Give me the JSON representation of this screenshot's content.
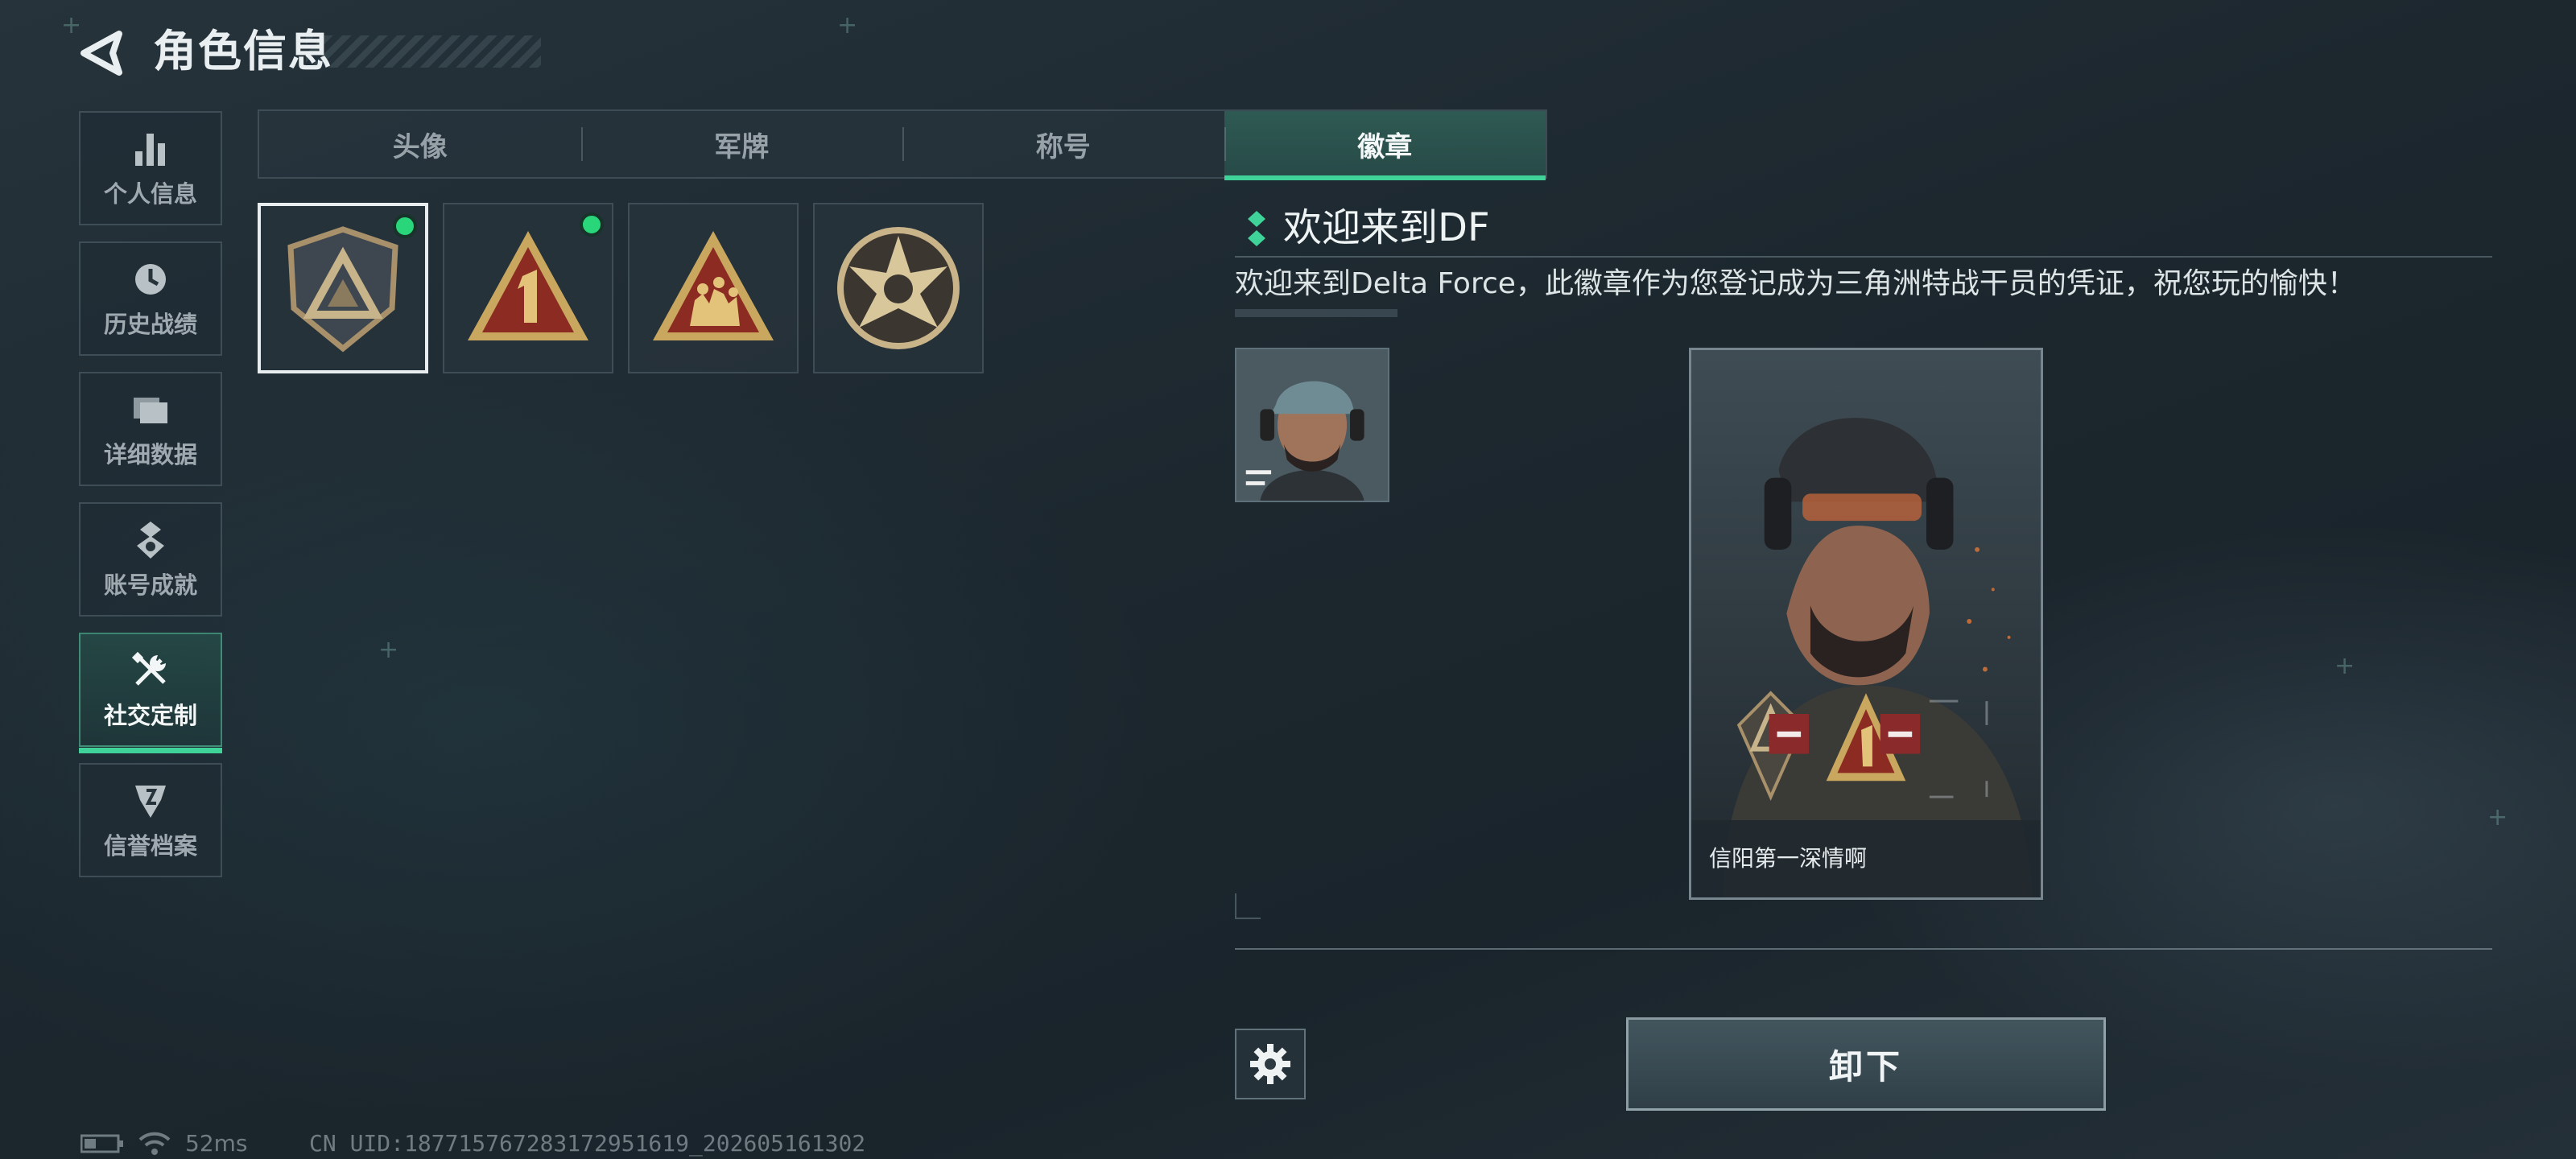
{
  "header": {
    "title": "角色信息",
    "back_icon": "back-arrow-icon"
  },
  "sidebar": {
    "items": [
      {
        "label": "个人信息",
        "icon": "bar-chart-icon",
        "active": false
      },
      {
        "label": "历史战绩",
        "icon": "clock-icon",
        "active": false
      },
      {
        "label": "详细数据",
        "icon": "folder-icon",
        "active": false
      },
      {
        "label": "账号成就",
        "icon": "medal-icon",
        "active": false
      },
      {
        "label": "社交定制",
        "icon": "tools-icon",
        "active": true
      },
      {
        "label": "信誉档案",
        "icon": "shield-badge-icon",
        "active": false
      }
    ]
  },
  "tabs": [
    {
      "label": "头像",
      "active": false
    },
    {
      "label": "军牌",
      "active": false
    },
    {
      "label": "称号",
      "active": false
    },
    {
      "label": "徽章",
      "active": true
    }
  ],
  "badges": [
    {
      "name": "shield-delta-badge",
      "equipped": true,
      "selected": true
    },
    {
      "name": "number-one-badge",
      "equipped": true,
      "selected": false
    },
    {
      "name": "squad-badge",
      "equipped": false,
      "selected": false
    },
    {
      "name": "star-badge",
      "equipped": false,
      "selected": false
    }
  ],
  "detail": {
    "title": "欢迎来到DF",
    "description": "欢迎来到Delta Force，此徽章作为您登记成为三角洲特战干员的凭证，祝您玩的愉快！"
  },
  "card": {
    "player_name": "信阳第一深情啊"
  },
  "actions": {
    "unequip_label": "卸下",
    "settings_icon": "gear-icon"
  },
  "status": {
    "ping": "52ms",
    "uid": "CN UID:18771576728317295161​9_202605161302"
  },
  "colors": {
    "accent": "#3fd39a",
    "equipped_dot": "#29d67a",
    "remove": "#8a2a2a"
  }
}
